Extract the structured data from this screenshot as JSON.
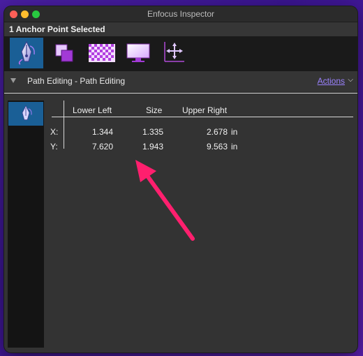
{
  "window": {
    "title": "Enfocus Inspector"
  },
  "status": {
    "text": "1 Anchor Point Selected"
  },
  "toolbar": {
    "tools": [
      {
        "name": "pen-tool-icon",
        "active": true
      },
      {
        "name": "layers-icon",
        "active": false
      },
      {
        "name": "transparency-checker-icon",
        "active": false
      },
      {
        "name": "monitor-icon",
        "active": false
      },
      {
        "name": "move-axes-icon",
        "active": false
      }
    ]
  },
  "section": {
    "title": "Path Editing - Path Editing",
    "actions_label": "Actions"
  },
  "table": {
    "headers": {
      "lower_left": "Lower Left",
      "size": "Size",
      "upper_right": "Upper Right"
    },
    "rows": [
      {
        "label": "X:",
        "lower_left": "1.344",
        "size": "1.335",
        "upper_right": "2.678",
        "unit": "in"
      },
      {
        "label": "Y:",
        "lower_left": "7.620",
        "size": "1.943",
        "upper_right": "9.563",
        "unit": "in"
      }
    ]
  },
  "colors": {
    "accent": "#1a5f96",
    "link": "#9b82ff",
    "annotation_arrow": "#ff1f6e"
  }
}
